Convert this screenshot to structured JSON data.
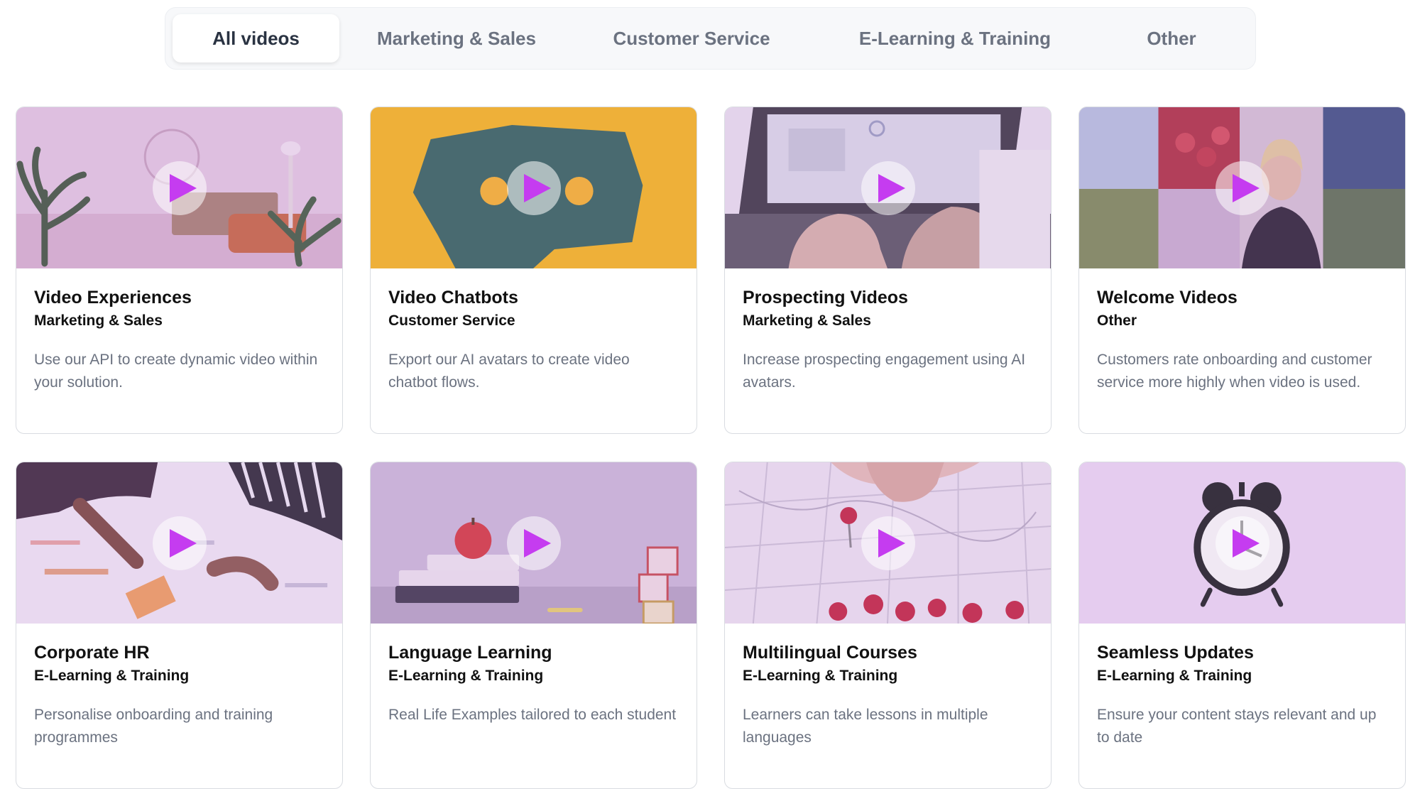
{
  "tabs": [
    {
      "label": "All videos",
      "active": true
    },
    {
      "label": "Marketing & Sales",
      "active": false
    },
    {
      "label": "Customer Service",
      "active": false
    },
    {
      "label": "E-Learning & Training",
      "active": false
    },
    {
      "label": "Other",
      "active": false
    }
  ],
  "cards": [
    {
      "title": "Video Experiences",
      "category": "Marketing & Sales",
      "description": "Use our API to create dynamic video within your solution.",
      "thumbnail": "living-room"
    },
    {
      "title": "Video Chatbots",
      "category": "Customer Service",
      "description": "Export our AI avatars to create video chatbot flows.",
      "thumbnail": "paper-speech-bubble"
    },
    {
      "title": "Prospecting Videos",
      "category": "Marketing & Sales",
      "description": "Increase prospecting engagement using AI avatars.",
      "thumbnail": "laptop-typing"
    },
    {
      "title": "Welcome Videos",
      "category": "Other",
      "description": "Customers rate onboarding and customer service more highly when video is used.",
      "thumbnail": "presenter-collage"
    },
    {
      "title": "Corporate HR",
      "category": "E-Learning & Training",
      "description": "Personalise onboarding and training programmes",
      "thumbnail": "desk-charts"
    },
    {
      "title": "Language Learning",
      "category": "E-Learning & Training",
      "description": "Real Life Examples tailored to each student",
      "thumbnail": "apple-books-blocks"
    },
    {
      "title": "Multilingual Courses",
      "category": "E-Learning & Training",
      "description": "Learners can take lessons in multiple languages",
      "thumbnail": "map-pin"
    },
    {
      "title": "Seamless Updates",
      "category": "E-Learning & Training",
      "description": "Ensure your content stays relevant and up to date",
      "thumbnail": "alarm-clock"
    }
  ],
  "colors": {
    "play_triangle": "#c53cf0",
    "active_tab_text": "#2a3342",
    "inactive_tab_text": "#6b7280"
  }
}
